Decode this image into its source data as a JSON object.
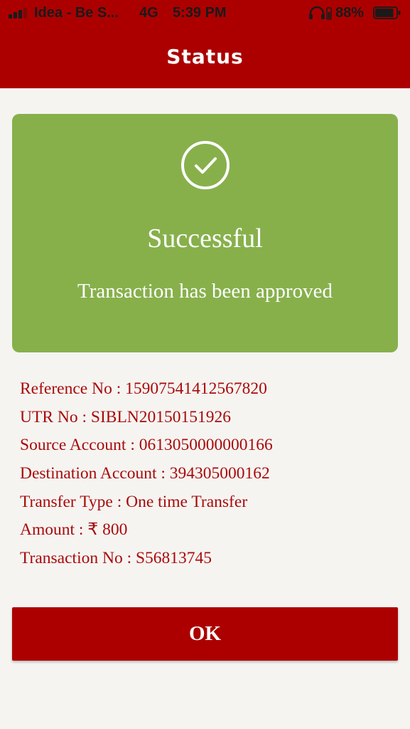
{
  "status_bar": {
    "carrier": "Idea - Be S...",
    "network": "4G",
    "time": "5:39 PM",
    "battery_percent": "88%",
    "battery_level": 0.88,
    "icons": [
      "signal-icon",
      "headphones-icon",
      "battery-icon"
    ]
  },
  "header": {
    "title": "Status"
  },
  "result": {
    "title": "Successful",
    "message": "Transaction has been approved",
    "icon": "check-circle-icon"
  },
  "details": [
    "Reference No : 15907541412567820",
    "UTR No : SIBLN20150151926",
    "Source Account : 0613050000000166",
    "Destination Account : 394305000162",
    "Transfer Type : One time Transfer",
    "Amount : ₹ 800",
    "Transaction No : S56813745"
  ],
  "actions": {
    "ok_label": "OK"
  },
  "colors": {
    "brand_red": "#ac0000",
    "success_green": "#87b04b",
    "detail_text": "#a80a0a",
    "background": "#f5f4f1"
  }
}
